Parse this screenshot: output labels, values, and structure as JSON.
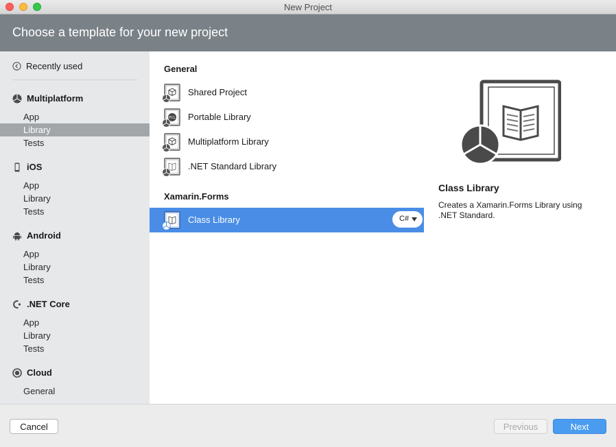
{
  "window": {
    "title": "New Project"
  },
  "header": {
    "title": "Choose a template for your new project"
  },
  "sidebar": {
    "recent": {
      "label": "Recently used",
      "icon": "clock-icon"
    },
    "categories": [
      {
        "label": "Multiplatform",
        "icon": "pie-icon",
        "items": [
          "App",
          "Library",
          "Tests"
        ],
        "selected": "Library"
      },
      {
        "label": "iOS",
        "icon": "phone-icon",
        "items": [
          "App",
          "Library",
          "Tests"
        ]
      },
      {
        "label": "Android",
        "icon": "android-icon",
        "items": [
          "App",
          "Library",
          "Tests"
        ]
      },
      {
        "label": ".NET Core",
        "icon": "dotnet-core-icon",
        "items": [
          "App",
          "Library",
          "Tests"
        ]
      },
      {
        "label": "Cloud",
        "icon": "cloud-icon",
        "items": [
          "General"
        ]
      }
    ]
  },
  "templates": {
    "groups": [
      {
        "label": "General",
        "items": [
          {
            "label": "Shared Project",
            "icon": "shared-project-icon"
          },
          {
            "label": "Portable Library",
            "icon": "portable-library-icon"
          },
          {
            "label": "Multiplatform Library",
            "icon": "multiplatform-library-icon"
          },
          {
            "label": ".NET Standard Library",
            "icon": "netstandard-library-icon"
          }
        ]
      },
      {
        "label": "Xamarin.Forms",
        "items": [
          {
            "label": "Class Library",
            "icon": "class-library-icon",
            "selected": true,
            "language": "C#"
          }
        ]
      }
    ]
  },
  "preview": {
    "title": "Class Library",
    "description": "Creates a Xamarin.Forms Library using .NET Standard.",
    "icon": "class-library-large-icon"
  },
  "footer": {
    "cancel_label": "Cancel",
    "previous_label": "Previous",
    "next_label": "Next"
  },
  "colors": {
    "accent": "#4a8de6",
    "banner": "#7a8288",
    "next_button": "#4a9cf0"
  }
}
